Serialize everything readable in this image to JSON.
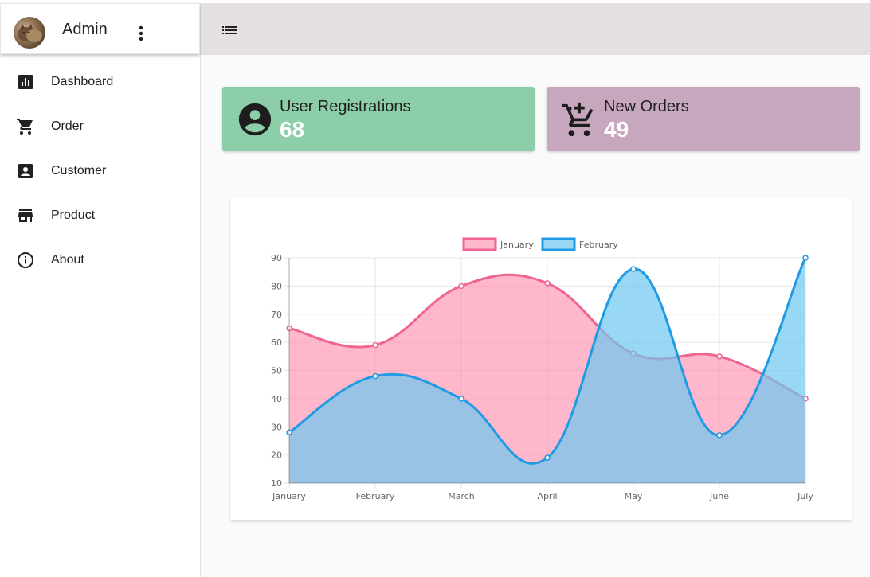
{
  "sidebar": {
    "admin_name": "Admin",
    "items": [
      {
        "label": "Dashboard",
        "icon": "bar-chart-icon"
      },
      {
        "label": "Order",
        "icon": "cart-icon"
      },
      {
        "label": "Customer",
        "icon": "contact-card-icon"
      },
      {
        "label": "Product",
        "icon": "store-icon"
      },
      {
        "label": "About",
        "icon": "info-icon"
      }
    ]
  },
  "cards": [
    {
      "title": "User Registrations",
      "value": "68",
      "icon": "account-circle-icon",
      "color": "#8bcea8"
    },
    {
      "title": "New Orders",
      "value": "49",
      "icon": "add-shopping-cart-icon",
      "color": "#c7a7be"
    }
  ],
  "colors": {
    "appbar": "#e4e0e0",
    "series_january": "#f06292",
    "series_february": "#1e9be4"
  },
  "chart_data": {
    "type": "line",
    "categories": [
      "January",
      "February",
      "March",
      "April",
      "May",
      "June",
      "July"
    ],
    "series": [
      {
        "name": "January",
        "values": [
          65,
          59,
          80,
          81,
          56,
          55,
          40
        ],
        "stroke": "#f0658f",
        "fill": "rgba(255,145,175,0.65)"
      },
      {
        "name": "February",
        "values": [
          28,
          48,
          40,
          19,
          86,
          27,
          90
        ],
        "stroke": "#1e9be4",
        "fill": "rgba(110,200,240,0.7)"
      }
    ],
    "ylim": [
      10,
      90
    ],
    "yticks": [
      "10",
      "20",
      "30",
      "40",
      "50",
      "60",
      "70",
      "80",
      "90"
    ],
    "grid": true,
    "fill": true,
    "smooth": true,
    "legend_position": "top"
  }
}
